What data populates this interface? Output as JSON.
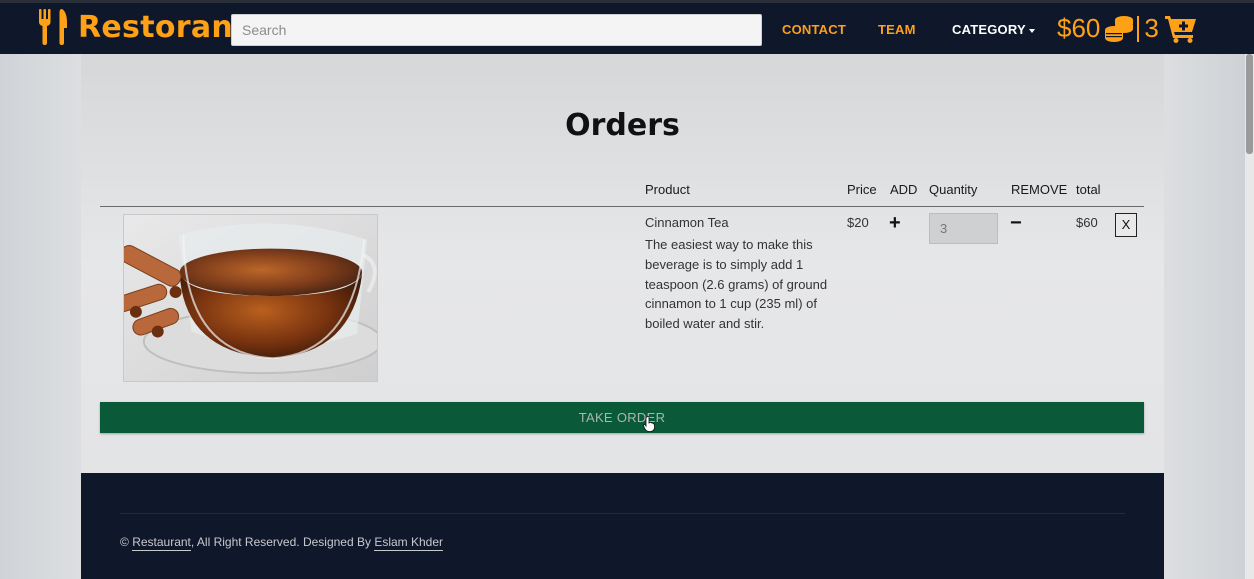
{
  "navbar": {
    "brand": "Restoran",
    "search_placeholder": "Search",
    "links": {
      "contact": "CONTACT",
      "team": "TEAM",
      "category": "CATEGORY"
    },
    "wallet_amount": "$60",
    "cart_count": "3",
    "icons": {
      "brand": "utensils-icon",
      "wallet": "coins-icon",
      "cart": "cart-plus-icon"
    }
  },
  "orders": {
    "title": "Orders",
    "headers": {
      "product": "Product",
      "price": "Price",
      "add": "ADD",
      "quantity": "Quantity",
      "remove": "REMOVE",
      "total": "total"
    },
    "items": [
      {
        "name": "Cinnamon Tea",
        "description": "The easiest way to make this beverage is to simply add 1 teaspoon (2.6 grams) of ground cinnamon to 1 cup (235 ml) of boiled water and stir.",
        "price": "$20",
        "add": "+",
        "quantity": "3",
        "remove": "−",
        "total": "$60",
        "delete": "X"
      }
    ],
    "take_order": "TAKE ORDER"
  },
  "footer": {
    "copyright_prefix": "© ",
    "site_link": "Restaurant",
    "middle": ", All Right Reserved. Designed By ",
    "designer_link": "Eslam Khder"
  },
  "colors": {
    "accent": "#fea116",
    "navbar_bg": "#0f172b",
    "button_green": "#0a5a3a"
  }
}
